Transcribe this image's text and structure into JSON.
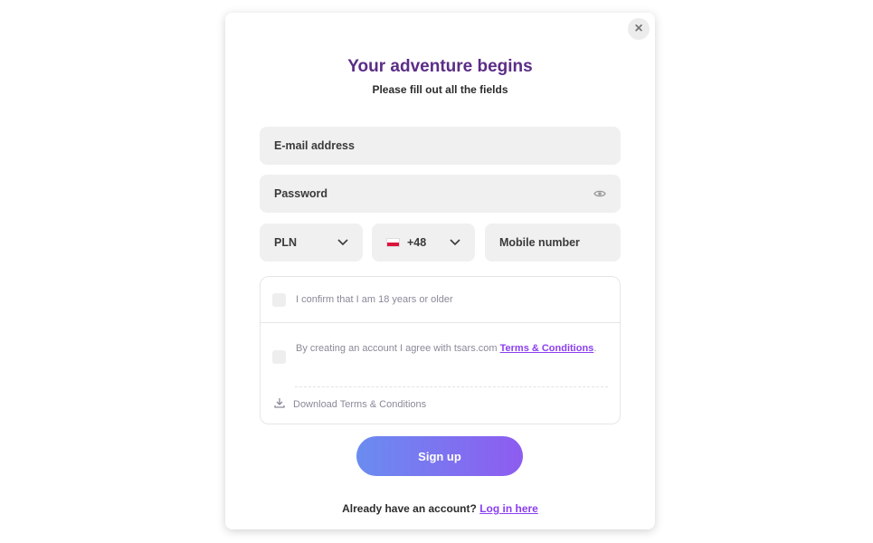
{
  "modal": {
    "close_label": "×",
    "title": "Your adventure begins",
    "subtitle": "Please fill out all the fields",
    "email_placeholder": "E-mail address",
    "password_placeholder": "Password",
    "currency_value": "PLN",
    "phone_prefix": "+48",
    "mobile_placeholder": "Mobile number",
    "age_confirm": "I confirm that I am 18 years or older",
    "terms_text": "By creating an account I agree with tsars.com ",
    "terms_link": "Terms & Conditions",
    "terms_period": ".",
    "download_terms": "Download Terms & Conditions",
    "signup_label": "Sign up",
    "login_prompt": "Already have an account? ",
    "login_link": "Log in here"
  },
  "colors": {
    "title": "#5b2d86",
    "link": "#8a3ff0",
    "button_gradient_start": "#6a8cf0",
    "button_gradient_end": "#8e5cf0"
  },
  "icons": [
    "close-icon",
    "eye-icon",
    "chevron-down-icon",
    "poland-flag-icon",
    "download-icon"
  ]
}
